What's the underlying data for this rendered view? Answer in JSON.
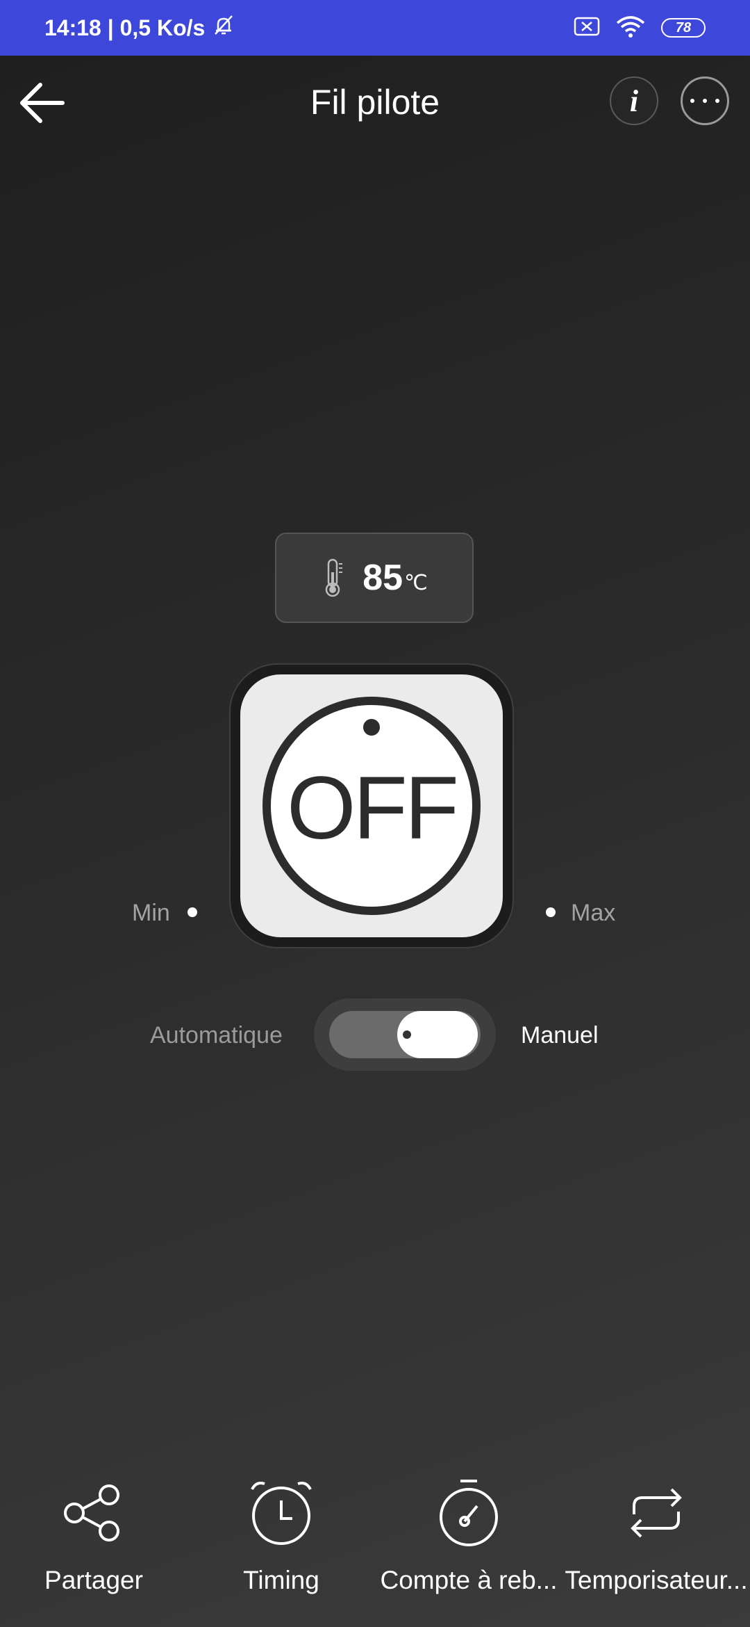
{
  "status_bar": {
    "time_speed": "14:18 | 0,5 Ko/s",
    "battery": "78",
    "icons": [
      "mute-bell-icon",
      "sim-off-icon",
      "wifi-icon",
      "battery-icon"
    ]
  },
  "header": {
    "title": "Fil pilote",
    "icons": [
      "back-arrow-icon",
      "info-icon",
      "more-icon"
    ]
  },
  "temperature": {
    "value": "85",
    "unit": "℃",
    "icon": "thermometer-icon"
  },
  "power": {
    "label": "OFF",
    "min_label": "Min",
    "max_label": "Max"
  },
  "mode": {
    "auto_label": "Automatique",
    "manual_label": "Manuel",
    "selected": "Manuel"
  },
  "bottom_nav": [
    {
      "label": "Partager",
      "icon": "share-icon"
    },
    {
      "label": "Timing",
      "icon": "alarm-clock-icon"
    },
    {
      "label": "Compte à reb...",
      "icon": "stopwatch-icon"
    },
    {
      "label": "Temporisateur...",
      "icon": "repeat-icon"
    }
  ],
  "colors": {
    "status_bar": "#3d47d9",
    "background": "#2a2a2a",
    "accent": "#ffffff"
  }
}
